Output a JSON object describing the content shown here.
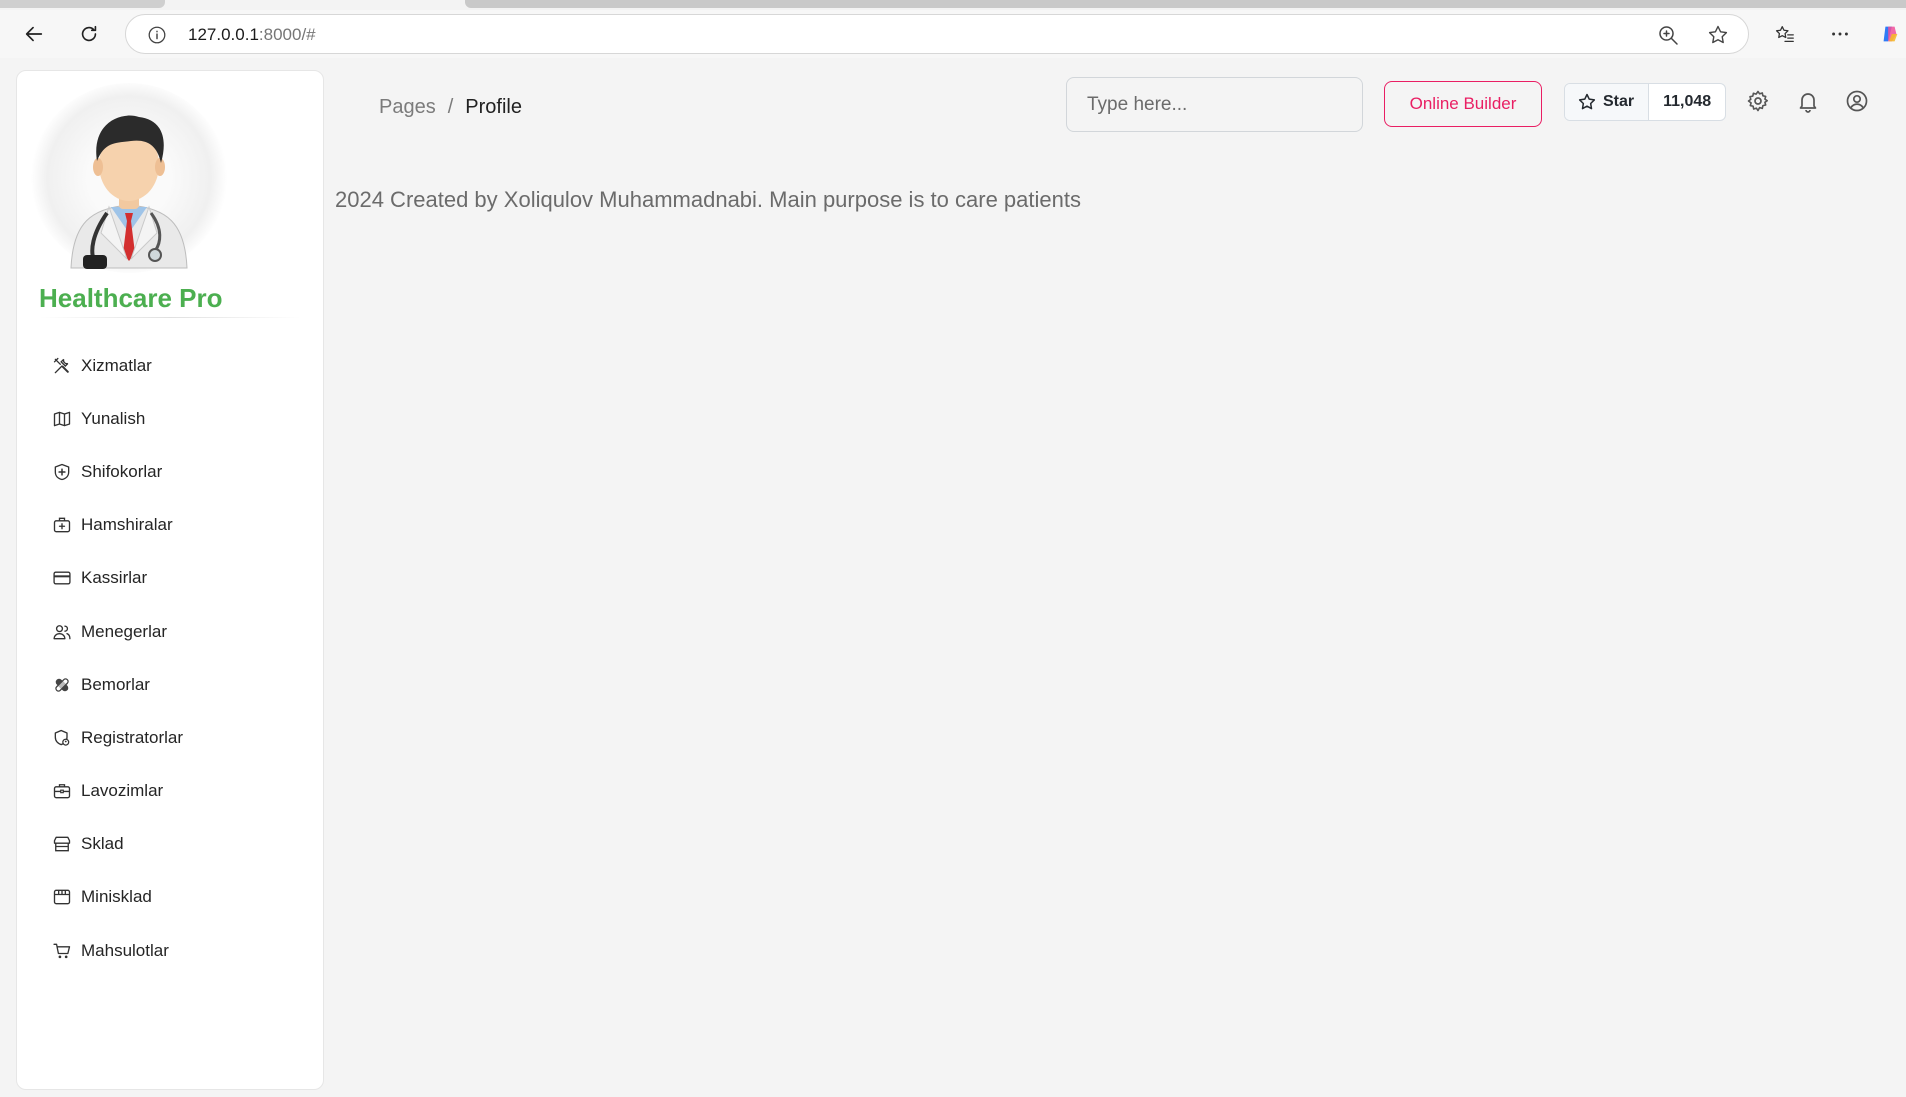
{
  "browser": {
    "url_host": "127.0.0.1",
    "url_rest": ":8000/#"
  },
  "sidebar": {
    "brand": "Healthcare Pro",
    "brand_color": "#4caf50",
    "items": [
      {
        "label": "Xizmatlar",
        "icon": "tools-icon"
      },
      {
        "label": "Yunalish",
        "icon": "map-icon"
      },
      {
        "label": "Shifokorlar",
        "icon": "shield-plus-icon"
      },
      {
        "label": "Hamshiralar",
        "icon": "medical-kit-icon"
      },
      {
        "label": "Kassirlar",
        "icon": "credit-card-icon"
      },
      {
        "label": "Menegerlar",
        "icon": "users-icon"
      },
      {
        "label": "Bemorlar",
        "icon": "bandage-icon"
      },
      {
        "label": "Registratorlar",
        "icon": "shield-user-icon"
      },
      {
        "label": "Lavozimlar",
        "icon": "briefcase-icon"
      },
      {
        "label": "Sklad",
        "icon": "warehouse-icon"
      },
      {
        "label": "Minisklad",
        "icon": "store-icon"
      },
      {
        "label": "Mahsulotlar",
        "icon": "cart-icon"
      }
    ]
  },
  "navbar": {
    "breadcrumb_parent": "Pages",
    "breadcrumb_separator": "/",
    "breadcrumb_current": "Profile",
    "search_placeholder": "Type here...",
    "builder_label": "Online Builder",
    "builder_color": "#e91e63",
    "github_star_label": "Star",
    "github_star_count": "11,048"
  },
  "content": {
    "footer_text": "2024 Created by Xoliqulov Muhammadnabi. Main purpose is to care patients"
  }
}
